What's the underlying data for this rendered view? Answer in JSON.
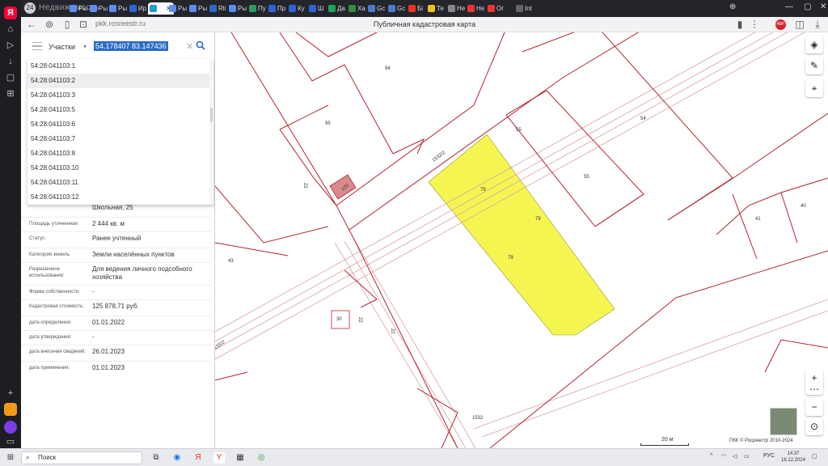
{
  "tabs": {
    "badge": "24",
    "site_mark": "Недвижимость",
    "labels": [
      "Ры",
      "Ры",
      "Ры",
      "Ир",
      "",
      "Ры",
      "Ры",
      "Rli",
      "Ры",
      "Пу",
      "Пр",
      "Ку",
      "Ш",
      "Да",
      "Ха",
      "Gc",
      "Gc",
      "Бі",
      "Те",
      "Не",
      "Не",
      "Ог",
      "Int"
    ]
  },
  "address_bar": {
    "url": "pkk.rosreestr.ru",
    "page_title": "Публичная кадастровая карта",
    "abp_label": "ABP"
  },
  "panel": {
    "search_type": "Участки",
    "search_value": "54.178407 83.147436",
    "suggestions": [
      "54:28:041103:1",
      "54:28:041103:2",
      "54:28:041103:3",
      "54:28:041103:5",
      "54:28:041103:6",
      "54:28:041103:7",
      "54:28:041103:8",
      "54:28:041103:10",
      "54:28:041103:11",
      "54:28:041103:12"
    ],
    "address": "Школьная, 25",
    "rows": [
      {
        "label": "Площадь уточненная:",
        "value": "2 444 кв. м"
      },
      {
        "label": "Статус:",
        "value": "Ранее учтенный"
      },
      {
        "label": "Категория земель:",
        "value": "Земли населённых пунктов"
      },
      {
        "label": "Разрешенное использование:",
        "value": "Для ведения личного подсобного хозяйства"
      },
      {
        "label": "Форма собственности:",
        "value": "-"
      },
      {
        "label": "Кадастровая стоимость:",
        "value": "125 878,71 руб."
      },
      {
        "label": "дата определения:",
        "value": "01.01.2022"
      },
      {
        "label": "дата утверждения:",
        "value": "-"
      },
      {
        "label": "дата внесения сведений:",
        "value": "26.01.2023"
      },
      {
        "label": "дата применения:",
        "value": "01.01.2023"
      }
    ]
  },
  "map": {
    "labels": [
      "94",
      "95",
      "55",
      "54",
      "55",
      "79",
      "79",
      "79",
      "41",
      "40",
      "43",
      "30",
      "22",
      "22",
      "22",
      "1532",
      "1532/2",
      "155/2",
      "120"
    ],
    "scale_label": "20 м",
    "copyright": "ПКК © Росреестр 2010-2024",
    "highlight_color": "#f5f552",
    "parcel_color": "#b22530"
  },
  "taskbar": {
    "search_label": "Поиск",
    "lang": "РУС",
    "time": "14:37",
    "date": "18.12.2024"
  }
}
